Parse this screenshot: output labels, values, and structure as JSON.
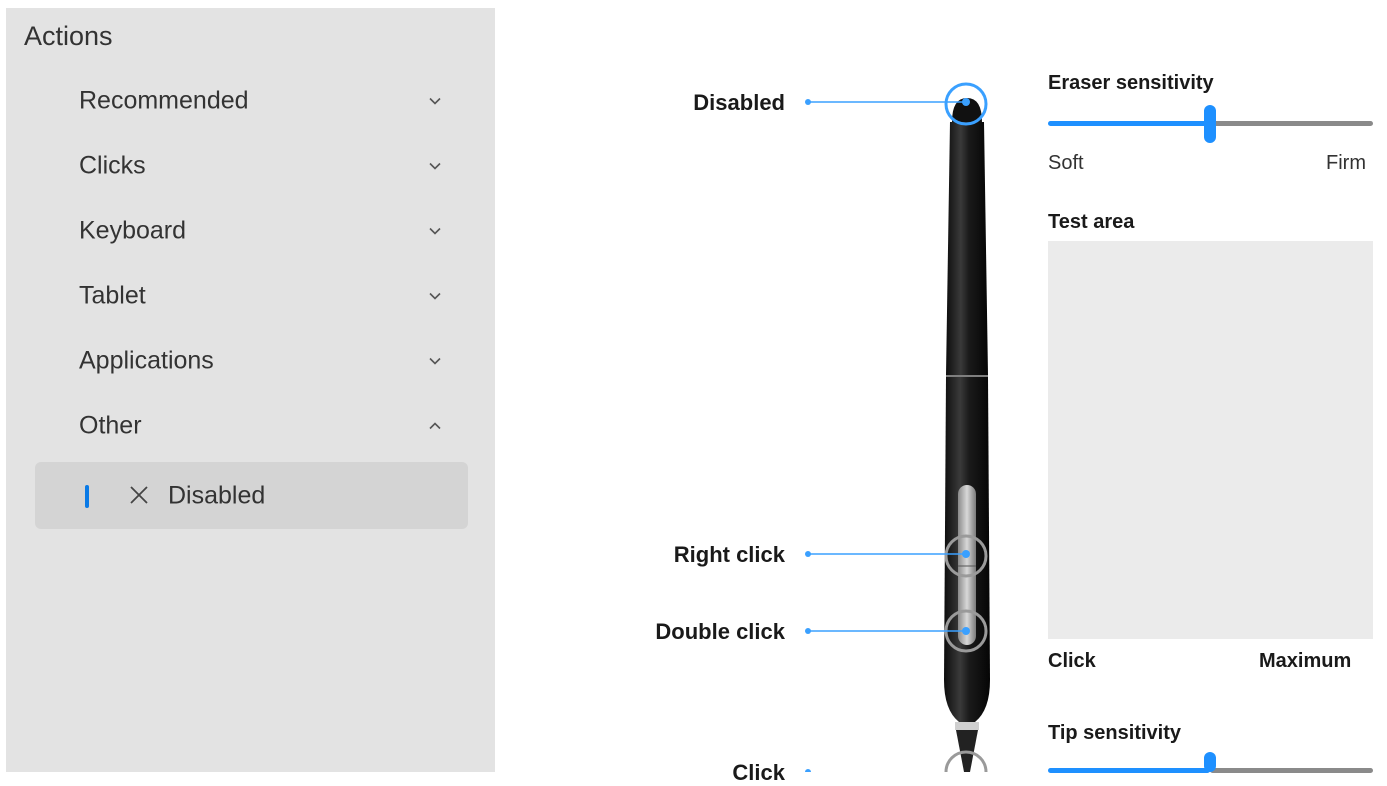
{
  "actions": {
    "title": "Actions",
    "categories": [
      {
        "label": "Recommended",
        "expanded": false
      },
      {
        "label": "Clicks",
        "expanded": false
      },
      {
        "label": "Keyboard",
        "expanded": false
      },
      {
        "label": "Tablet",
        "expanded": false
      },
      {
        "label": "Applications",
        "expanded": false
      },
      {
        "label": "Other",
        "expanded": true
      }
    ],
    "selected_item": {
      "label": "Disabled",
      "icon": "close-x-icon"
    }
  },
  "pen": {
    "callouts": {
      "eraser": "Disabled",
      "upper_button": "Right click",
      "lower_button": "Double click",
      "tip": "Click"
    }
  },
  "eraser_sensitivity": {
    "title": "Eraser sensitivity",
    "value_fraction": 0.5,
    "min_label": "Soft",
    "max_label": "Firm"
  },
  "test_area": {
    "title": "Test area",
    "left_label": "Click",
    "right_label": "Maximum"
  },
  "tip_sensitivity": {
    "title": "Tip sensitivity",
    "value_fraction": 0.5
  },
  "colors": {
    "accent": "#1e90ff",
    "panel_bg": "#e3e3e3",
    "selected_bg": "#d4d4d4",
    "track_inactive": "#8a8a8a"
  }
}
